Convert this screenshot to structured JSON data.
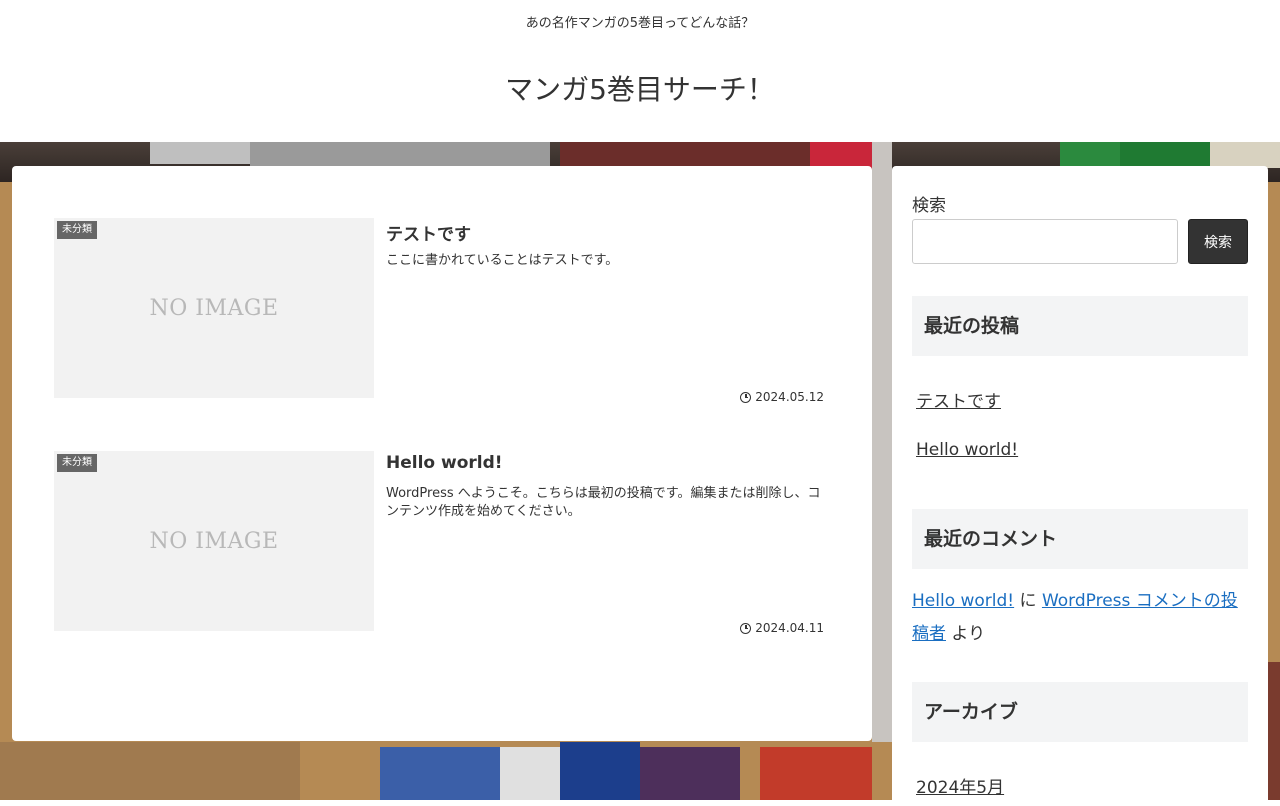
{
  "header": {
    "tagline": "あの名作マンガの5巻目ってどんな話？",
    "site_title": "マンガ5巻目サーチ！"
  },
  "posts": [
    {
      "category": "未分類",
      "thumbnail_text": "NO IMAGE",
      "title": "テストです",
      "excerpt": "ここに書かれていることはテストです。",
      "date": "2024.05.12"
    },
    {
      "category": "未分類",
      "thumbnail_text": "NO IMAGE",
      "title": "Hello world!",
      "excerpt": "WordPress へようこそ。こちらは最初の投稿です。編集または削除し、コンテンツ作成を始めてください。",
      "date": "2024.04.11"
    }
  ],
  "sidebar": {
    "search": {
      "label": "検索",
      "value": "",
      "placeholder": "",
      "button_label": "検索"
    },
    "recent_posts": {
      "heading": "最近の投稿",
      "items": [
        "テストです",
        "Hello world!"
      ]
    },
    "recent_comments": {
      "heading": "最近のコメント",
      "post_link": "Hello world!",
      "connector": "に",
      "author_link": "WordPress コメントの投稿者",
      "suffix": "より"
    },
    "archives": {
      "heading": "アーカイブ",
      "items": [
        "2024年5月"
      ]
    }
  },
  "colors": {
    "link": "#1a6ec1",
    "button_bg": "#333333",
    "widget_head_bg": "#f3f4f5",
    "category_badge_bg": "#666666"
  },
  "icons": {
    "date": "clock-icon"
  }
}
